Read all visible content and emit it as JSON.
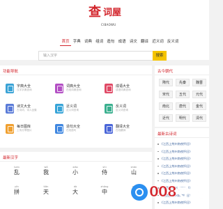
{
  "brand": {
    "logo_char": "查",
    "logo_name": "词屋",
    "logo_sub": "CIBAOWU"
  },
  "nav": [
    "首页",
    "字典",
    "词典",
    "组词",
    "造句",
    "成语",
    "诗文",
    "翻译",
    "近义词",
    "反义词"
  ],
  "search": {
    "placeholder": "输入汉字",
    "button": "搜索"
  },
  "apps_panel": {
    "title": "功能导航",
    "items": [
      {
        "name": "字典大全",
        "desc": "汉字字典查询",
        "color": "#3aa3d6"
      },
      {
        "name": "词典大全",
        "desc": "在线词典查询",
        "color": "#b34fc4"
      },
      {
        "name": "成语大全",
        "desc": "成语词典查询",
        "color": "#e04a66"
      },
      {
        "name": "诗文大全",
        "desc": "古诗词、诗人全集",
        "color": "#5a7bd8"
      },
      {
        "name": "近义词",
        "desc": "近义词查询",
        "color": "#37a4d8"
      },
      {
        "name": "反义词",
        "desc": "反义词查询",
        "color": "#3bb08f"
      },
      {
        "name": "每日图库",
        "desc": "上传分享图片",
        "color": "#f0a030"
      },
      {
        "name": "造句大全",
        "desc": "在线造句",
        "color": "#3f87e0"
      },
      {
        "name": "翻译大全",
        "desc": "在线翻译",
        "color": "#4a66d8"
      }
    ]
  },
  "dynasty_panel": {
    "title": "古今朝代",
    "items": [
      "隋代",
      "先秦",
      "魏晋",
      "宋代",
      "五代",
      "元代",
      "南北",
      "唐代",
      "金代",
      "近代",
      "明代",
      "清代"
    ]
  },
  "latest_poems_panel": {
    "title": "最新古诗词",
    "items": [
      "《江西上荆州南夜怀旧》",
      "《江西上荆州南夜怀旧》",
      "《江西上荆州南夜怀旧》",
      "《江西上荆州南夜怀旧》",
      "《江西上荆州南夜怀旧》",
      "《江西上荆州南夜怀旧》",
      "《江西上荆州南夜怀旧》",
      "《江西上荆州南夜怀旧》",
      "《江西上荆州南夜怀旧》"
    ]
  },
  "latest_chars_panel": {
    "title": "最新汉字",
    "chars": [
      {
        "py": "luàn",
        "hz": "乱"
      },
      {
        "py": "wǒ",
        "hz": "我"
      },
      {
        "py": "xiǎo",
        "hz": "小"
      },
      {
        "py": "shì",
        "hz": "侍"
      },
      {
        "py": "shān",
        "hz": "山"
      },
      {
        "py": "pīn",
        "hz": "拼"
      },
      {
        "py": "tiān",
        "hz": "天"
      },
      {
        "py": "dà",
        "hz": "大"
      },
      {
        "py": "zhōng",
        "hz": "中"
      },
      {
        "py": "gè",
        "hz": "个"
      }
    ]
  },
  "watermark": {
    "text": "008导航"
  }
}
